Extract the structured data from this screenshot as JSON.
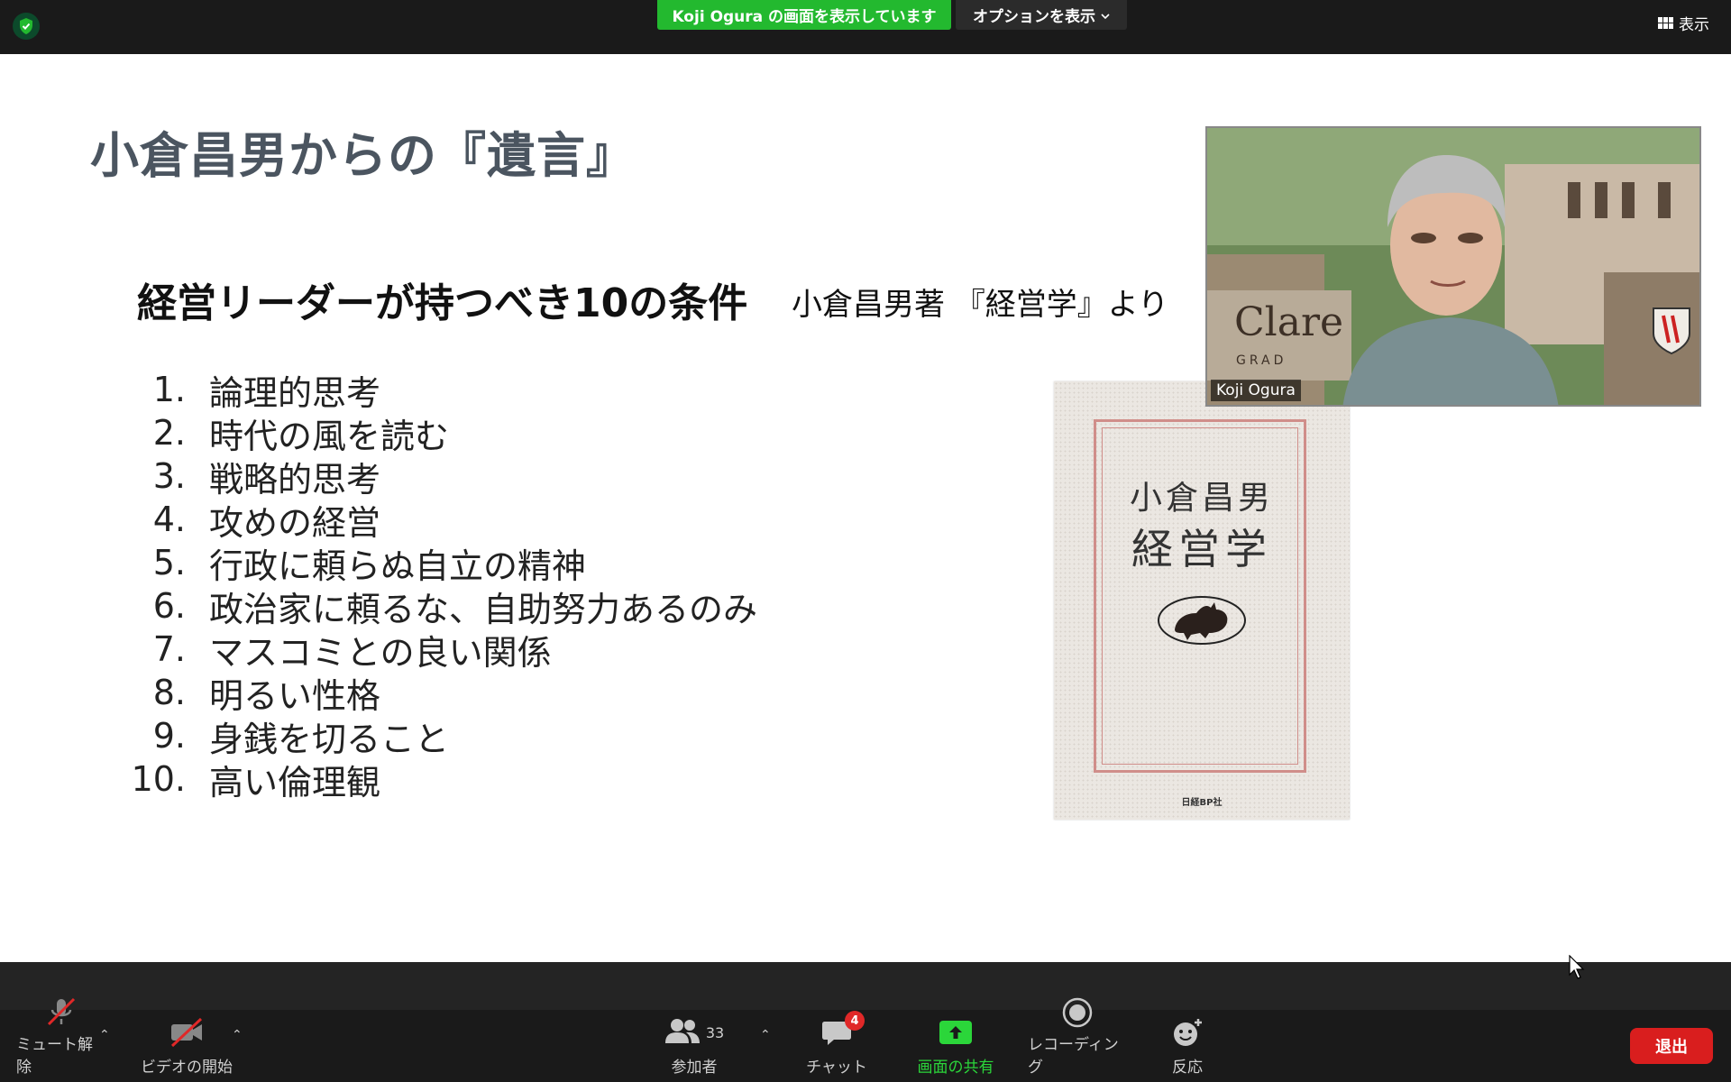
{
  "topbar": {
    "share_banner": "Koji Ogura の画面を表示しています",
    "options_label": "オプションを表示",
    "view_label": "表示"
  },
  "slide": {
    "title": "小倉昌男からの『遺言』",
    "subtitle_main": "経営リーダーが持つべき10の条件",
    "subtitle_source": "小倉昌男著 『経営学』より",
    "items": [
      {
        "num": "1.",
        "text": "論理的思考"
      },
      {
        "num": "2.",
        "text": "時代の風を読む"
      },
      {
        "num": "3.",
        "text": "戦略的思考"
      },
      {
        "num": "4.",
        "text": "攻めの経営"
      },
      {
        "num": "5.",
        "text": "行政に頼らぬ自立の精神"
      },
      {
        "num": "6.",
        "text": "政治家に頼るな、自助努力あるのみ"
      },
      {
        "num": "7.",
        "text": "マスコミとの良い関係"
      },
      {
        "num": "8.",
        "text": "明るい性格"
      },
      {
        "num": "9.",
        "text": "身銭を切ること"
      },
      {
        "num": "10.",
        "text": "高い倫理観"
      }
    ],
    "book": {
      "author": "小倉昌男",
      "title": "経営学",
      "publisher": "日経BP社"
    }
  },
  "video": {
    "participant_name": "Koji Ogura",
    "sign_text": "Clare",
    "sign_sub": "GRAD"
  },
  "toolbar": {
    "unmute_label": "ミュート解除",
    "video_label": "ビデオの開始",
    "participants_label": "参加者",
    "participants_count": "33",
    "chat_label": "チャット",
    "chat_badge": "4",
    "share_label": "画面の共有",
    "recording_label": "レコーディング",
    "reactions_label": "反応",
    "leave_label": "退出"
  },
  "colors": {
    "share_green": "#23b92f",
    "leave_red": "#d91e1e",
    "badge_red": "#e02828",
    "title_gray": "#4b5560"
  }
}
